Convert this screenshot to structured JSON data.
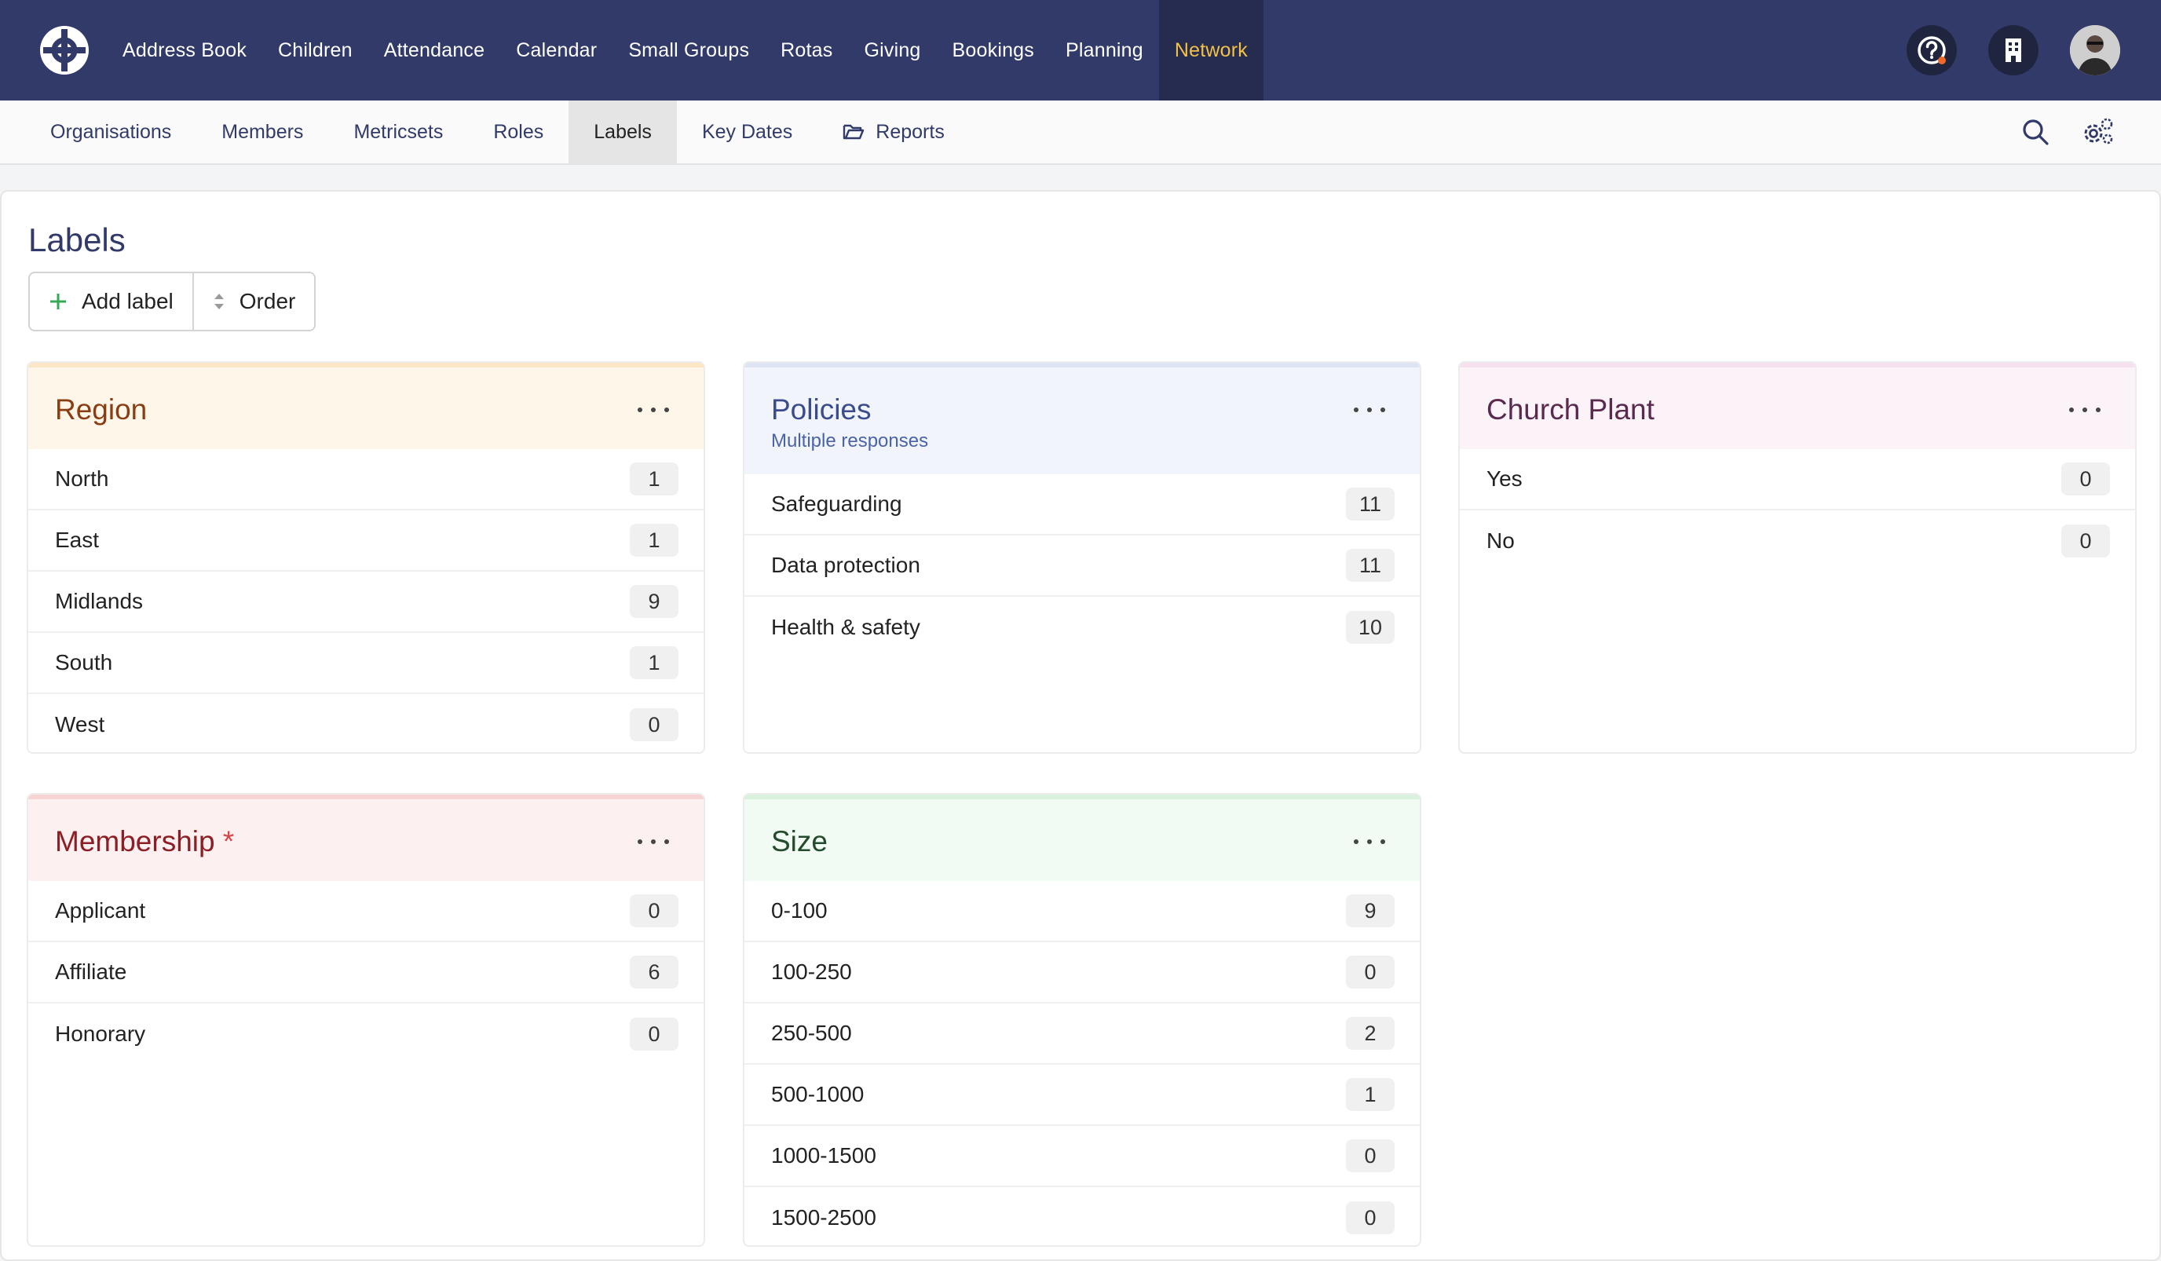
{
  "nav": {
    "items": [
      "Address Book",
      "Children",
      "Attendance",
      "Calendar",
      "Small Groups",
      "Rotas",
      "Giving",
      "Bookings",
      "Planning",
      "Network"
    ],
    "active": "Network",
    "icons": [
      "help-icon",
      "building-icon",
      "avatar"
    ]
  },
  "subnav": {
    "items": [
      "Organisations",
      "Members",
      "Metricsets",
      "Roles",
      "Labels",
      "Key Dates",
      "Reports"
    ],
    "active": "Labels",
    "tools": [
      "search-icon",
      "settings-icon"
    ]
  },
  "page": {
    "title": "Labels",
    "add_label": "Add label",
    "order": "Order"
  },
  "cards": {
    "region": {
      "title": "Region",
      "rows": [
        {
          "label": "North",
          "count": "1"
        },
        {
          "label": "East",
          "count": "1"
        },
        {
          "label": "Midlands",
          "count": "9"
        },
        {
          "label": "South",
          "count": "1"
        },
        {
          "label": "West",
          "count": "0"
        }
      ]
    },
    "policies": {
      "title": "Policies",
      "subtitle": "Multiple responses",
      "rows": [
        {
          "label": "Safeguarding",
          "count": "11"
        },
        {
          "label": "Data protection",
          "count": "11"
        },
        {
          "label": "Health & safety",
          "count": "10"
        }
      ]
    },
    "church_plant": {
      "title": "Church Plant",
      "rows": [
        {
          "label": "Yes",
          "count": "0"
        },
        {
          "label": "No",
          "count": "0"
        }
      ]
    },
    "membership": {
      "title": "Membership",
      "required": "*",
      "rows": [
        {
          "label": "Applicant",
          "count": "0"
        },
        {
          "label": "Affiliate",
          "count": "6"
        },
        {
          "label": "Honorary",
          "count": "0"
        }
      ]
    },
    "size": {
      "title": "Size",
      "rows": [
        {
          "label": "0-100",
          "count": "9"
        },
        {
          "label": "100-250",
          "count": "0"
        },
        {
          "label": "250-500",
          "count": "2"
        },
        {
          "label": "500-1000",
          "count": "1"
        },
        {
          "label": "1000-1500",
          "count": "0"
        },
        {
          "label": "1500-2500",
          "count": "0"
        }
      ]
    }
  },
  "colors": {
    "nav_bg": "#323a69",
    "nav_active_text": "#f2c145",
    "region": "#8a3d12",
    "policies": "#3a4c8c",
    "church_plant": "#5a2a4e",
    "membership": "#8c1f25",
    "size": "#234b2c"
  }
}
